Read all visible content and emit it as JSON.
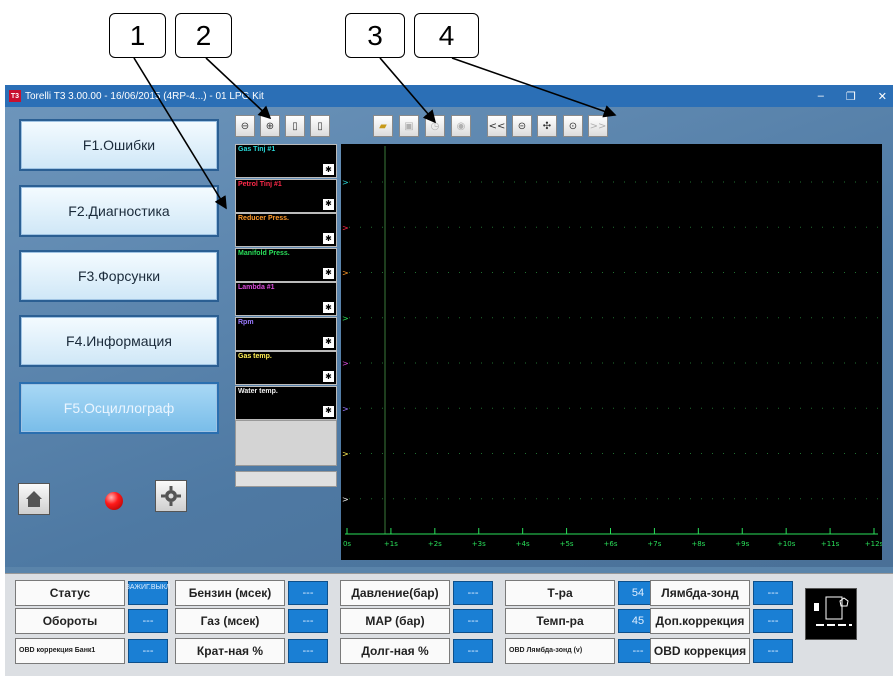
{
  "callouts": [
    "1",
    "2",
    "3",
    "4"
  ],
  "window": {
    "title": "Torelli T3 3.00.00 - 16/06/2015 (4RP-4...) - 01 LPG Kit",
    "controls": [
      "–",
      "❐",
      "✕"
    ],
    "app_icon": "T3"
  },
  "sidebar": {
    "buttons": [
      {
        "label": "F1.Ошибки"
      },
      {
        "label": "F2.Диагностика"
      },
      {
        "label": "F3.Форсунки"
      },
      {
        "label": "F4.Информация"
      },
      {
        "label": "F5.Осциллограф"
      }
    ],
    "home_icon": "home-icon",
    "settings_icon": "gear-icon",
    "led_color": "#ff1a1a"
  },
  "toolbar": {
    "icons": [
      "zoom-out-icon",
      "zoom-in-icon",
      "panel-left-icon",
      "panel-right-icon",
      "open-folder-icon",
      "save-icon",
      "record-icon",
      "stop-icon",
      "rewind-icon",
      "minus-circle-icon",
      "center-icon",
      "plus-circle-icon",
      "forward-icon"
    ],
    "rewind_label": "<<",
    "forward_label": ">>"
  },
  "channels": [
    {
      "label": "Gas Tinj #1",
      "color": "#29d6d6"
    },
    {
      "label": "Petrol Tinj #1",
      "color": "#ff2a4a"
    },
    {
      "label": "Reducer Press.",
      "color": "#ff9a2a"
    },
    {
      "label": "Manifold Press.",
      "color": "#2adf5a"
    },
    {
      "label": "Lambda #1",
      "color": "#d94ad9"
    },
    {
      "label": "Rpm",
      "color": "#9a7aff"
    },
    {
      "label": "Gas temp.",
      "color": "#ffee55"
    },
    {
      "label": "Water temp.",
      "color": "#f0f0f0"
    }
  ],
  "scope": {
    "x_ticks": [
      "0s",
      "+1s",
      "+2s",
      "+3s",
      "+4s",
      "+5s",
      "+6s",
      "+7s",
      "+8s",
      "+9s",
      "+10s",
      "+11s",
      "+12s"
    ],
    "grid_color": "#1f6f2f",
    "trace_colors": [
      "#29d6d6",
      "#ff2a4a",
      "#ff9a2a",
      "#2adf5a",
      "#d94ad9",
      "#9a7aff",
      "#ffee55",
      "#f0f0f0"
    ]
  },
  "status": {
    "row1": [
      {
        "label": "Статус",
        "value": "ЗАЖИГ.ВЫКЛ"
      },
      {
        "label": "Бензин (мсек)",
        "value": "---"
      },
      {
        "label": "Давление(бар)",
        "value": "---"
      },
      {
        "label": "Т-ра",
        "value": "54"
      },
      {
        "label": "Лямбда-зонд",
        "value": "---"
      }
    ],
    "row2": [
      {
        "label": "Обороты",
        "value": "---"
      },
      {
        "label": "Газ (мсек)",
        "value": "---"
      },
      {
        "label": "MAP (бар)",
        "value": "---"
      },
      {
        "label": "Темп-ра",
        "value": "45"
      },
      {
        "label": "Доп.коррекция",
        "value": "---"
      }
    ],
    "row3": [
      {
        "label": "OBD коррекция Банк1",
        "value": "---"
      },
      {
        "label": "Крат-ная %",
        "value": "---"
      },
      {
        "label": "Долг-ная %",
        "value": "---"
      },
      {
        "label": "OBD Лямбда-зонд (v)",
        "value": "---"
      },
      {
        "label": "OBD коррекция",
        "value": "---"
      }
    ],
    "diag_icon": "obd-connector-icon"
  }
}
